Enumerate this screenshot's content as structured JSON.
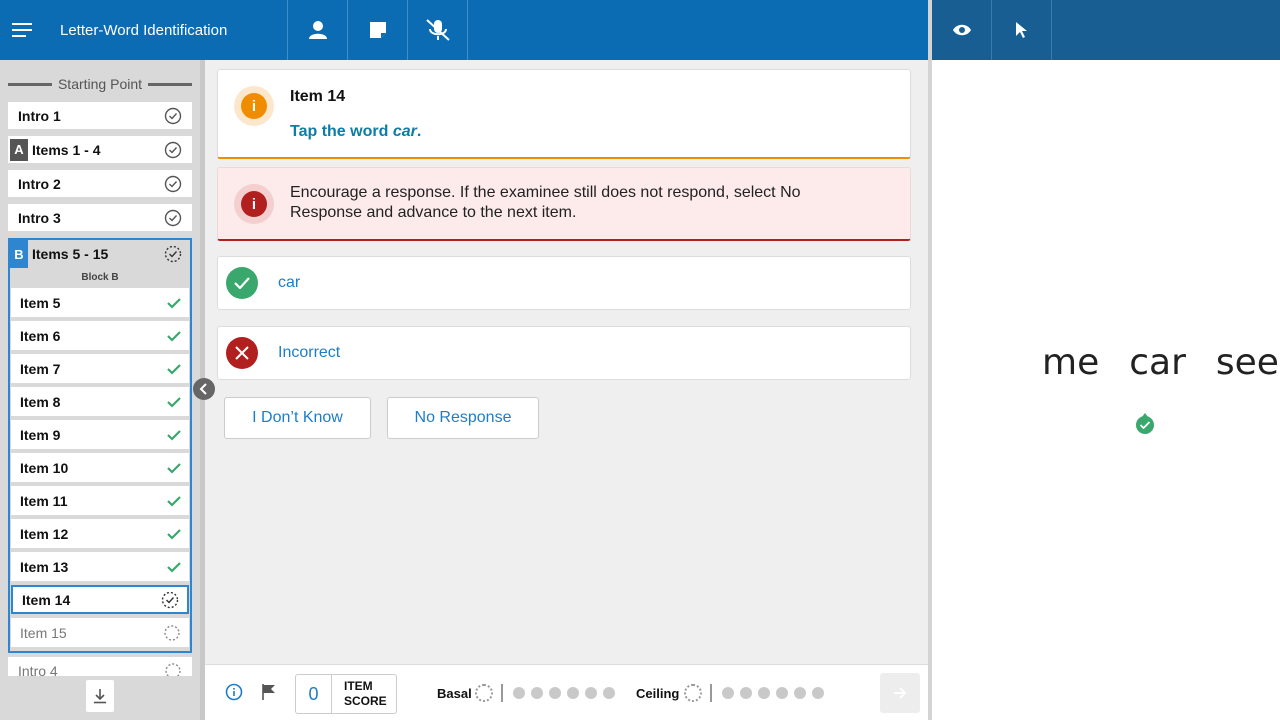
{
  "app": {
    "title": "Letter-Word Identification"
  },
  "toolbar": {
    "icons": [
      "menu-icon",
      "person-icon",
      "note-icon",
      "mic-off-icon"
    ],
    "right_icons": [
      "eye-icon",
      "pointer-icon"
    ]
  },
  "sidebar": {
    "heading": "Starting Point",
    "items_top": [
      {
        "label": "Intro 1",
        "badge": "",
        "status": "done"
      },
      {
        "label": "Items 1 - 4",
        "badge": "A",
        "status": "done"
      },
      {
        "label": "Intro 2",
        "badge": "",
        "status": "done"
      },
      {
        "label": "Intro 3",
        "badge": "",
        "status": "done"
      }
    ],
    "block": {
      "badge": "B",
      "label": "Items 5 - 15",
      "sublabel": "Block B",
      "items": [
        {
          "label": "Item 5",
          "status": "correct"
        },
        {
          "label": "Item 6",
          "status": "correct"
        },
        {
          "label": "Item 7",
          "status": "correct"
        },
        {
          "label": "Item 8",
          "status": "correct"
        },
        {
          "label": "Item 9",
          "status": "correct"
        },
        {
          "label": "Item 10",
          "status": "correct"
        },
        {
          "label": "Item 11",
          "status": "correct"
        },
        {
          "label": "Item 12",
          "status": "correct"
        },
        {
          "label": "Item 13",
          "status": "correct"
        },
        {
          "label": "Item 14",
          "status": "in-progress"
        },
        {
          "label": "Item 15",
          "status": "pending"
        }
      ]
    },
    "items_bottom": [
      {
        "label": "Intro 4",
        "status": "pending"
      }
    ]
  },
  "item": {
    "title": "Item 14",
    "prompt_prefix": "Tap the word ",
    "prompt_word": "car",
    "prompt_suffix": "."
  },
  "alert": {
    "text": "Encourage a response. If the examinee still does not respond, select No Response and advance to the next item."
  },
  "responses": {
    "correct_label": "car",
    "incorrect_label": "Incorrect"
  },
  "buttons": {
    "dont_know": "I Don’t Know",
    "no_response": "No Response"
  },
  "footer": {
    "item_score": "0",
    "item_score_label_1": "ITEM",
    "item_score_label_2": "SCORE",
    "basal_label": "Basal",
    "ceiling_label": "Ceiling"
  },
  "stimulus": {
    "words": [
      "me",
      "car",
      "see"
    ]
  },
  "colors": {
    "primary": "#0b6cb3",
    "accent": "#2e86d1",
    "correct": "#3aa76d",
    "incorrect": "#b21f1f",
    "info": "#f08c00"
  }
}
